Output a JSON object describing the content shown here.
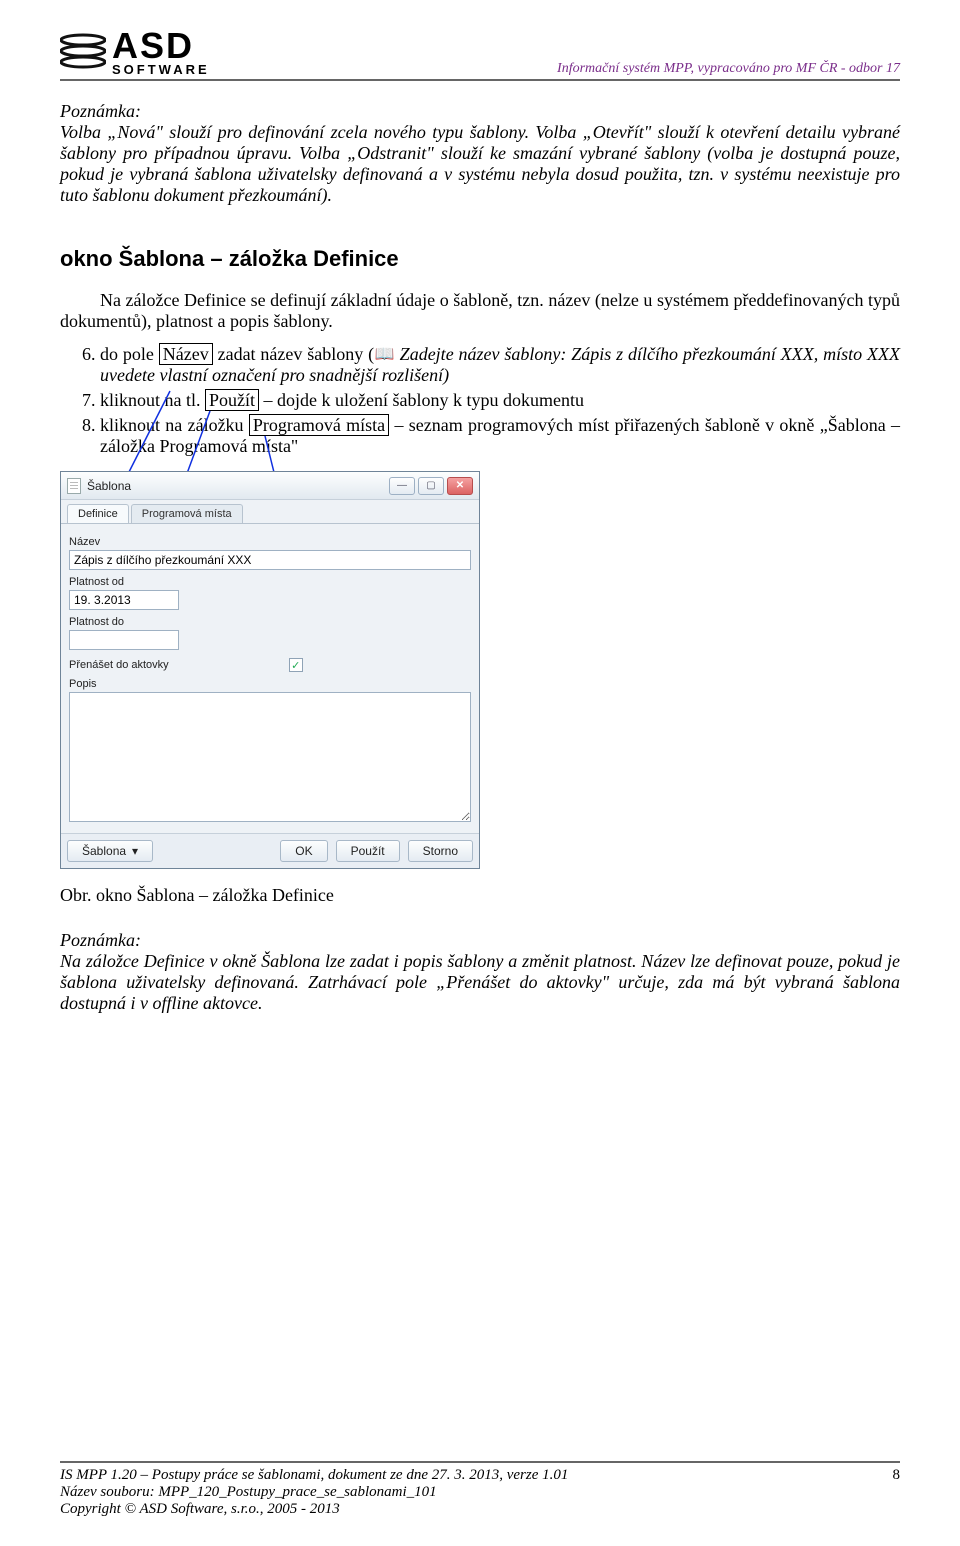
{
  "header": {
    "logo_top": "ASD",
    "logo_bottom": "SOFTWARE",
    "right": "Informační systém MPP, vypracováno pro MF ČR - odbor 17"
  },
  "note1_label": "Poznámka:",
  "note1_body": "Volba „Nová\" slouží pro definování zcela nového typu šablony. Volba „Otevřít\" slouží k otevření detailu vybrané šablony pro případnou úpravu. Volba „Odstranit\" slouží ke smazání vybrané šablony (volba je dostupná pouze, pokud je vybraná šablona uživatelsky definovaná a v systému nebyla dosud použita, tzn. v systému neexistuje pro tuto šablonu dokument přezkoumání).",
  "section_title": "okno Šablona – záložka Definice",
  "intro": "Na záložce Definice se definují základní údaje o šabloně, tzn. název (nelze u systémem předdefinovaných typů dokumentů), platnost a popis šablony.",
  "steps": {
    "s6_a": "do pole ",
    "s6_box": "Název",
    "s6_b": " zadat název šablony (",
    "s6_c": " Zadejte název šablony: Zápis z dílčího přezkoumání XXX, místo XXX uvedete vlastní označení pro snadnější rozlišení)",
    "s7_a": "kliknout na tl. ",
    "s7_box": "Použít",
    "s7_b": " – dojde k uložení šablony k typu dokumentu",
    "s8_a": "kliknout na záložku ",
    "s8_box": "Programová místa",
    "s8_b": " – seznam programových míst přiřazených šabloně v okně „Šablona – záložka Programová místa\""
  },
  "win": {
    "title": "Šablona",
    "tab1": "Definice",
    "tab2": "Programová místa",
    "lbl_nazev": "Název",
    "val_nazev": "Zápis z dílčího přezkoumání XXX",
    "lbl_platnost_od": "Platnost od",
    "val_platnost_od": "19. 3.2013",
    "lbl_platnost_do": "Platnost do",
    "lbl_prenaset": "Přenášet do aktovky",
    "chk_mark": "✓",
    "lbl_popis": "Popis",
    "btn_sablona": "Šablona",
    "btn_ok": "OK",
    "btn_pouzit": "Použít",
    "btn_storno": "Storno",
    "caret": "▾"
  },
  "caption": "Obr. okno Šablona – záložka Definice",
  "note2_label": "Poznámka:",
  "note2_body": "Na záložce Definice v okně Šablona lze zadat i popis šablony a změnit platnost. Název lze definovat pouze, pokud je šablona uživatelsky definovaná. Zatrhávací pole „Přenášet do aktovky\" určuje, zda má být vybraná šablona dostupná i v offline aktovce.",
  "footer": {
    "l1": "IS MPP 1.20 – Postupy práce se šablonami, dokument ze dne 27. 3. 2013, verze 1.01",
    "l2": "Název souboru: MPP_120_Postupy_prace_se_sablonami_101",
    "l3": "Copyright © ASD Software, s.r.o., 2005 - 2013",
    "page": "8"
  }
}
